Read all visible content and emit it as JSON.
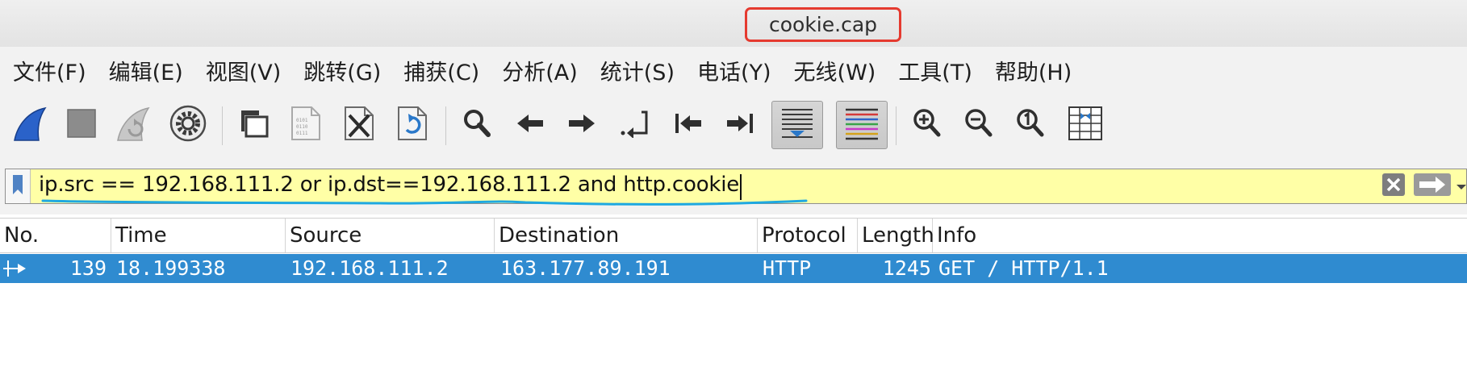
{
  "window": {
    "title": "cookie.cap"
  },
  "menu": [
    "文件(F)",
    "编辑(E)",
    "视图(V)",
    "跳转(G)",
    "捕获(C)",
    "分析(A)",
    "统计(S)",
    "电话(Y)",
    "无线(W)",
    "工具(T)",
    "帮助(H)"
  ],
  "toolbar": {
    "icons": [
      "shark-fin-start-icon",
      "stop-icon",
      "restart-icon",
      "capture-options-icon",
      "open-file-icon",
      "save-file-icon",
      "close-file-icon",
      "reload-file-icon",
      "find-packet-icon",
      "go-back-icon",
      "go-forward-icon",
      "go-to-packet-icon",
      "first-packet-icon",
      "last-packet-icon",
      "autoscroll-icon",
      "colorize-icon",
      "zoom-in-icon",
      "zoom-out-icon",
      "normal-size-icon",
      "resize-columns-icon"
    ]
  },
  "filter": {
    "value": "ip.src == 192.168.111.2 or ip.dst==192.168.111.2 and http.cookie",
    "background_color": "#ffffa6"
  },
  "columns": [
    "No.",
    "Time",
    "Source",
    "Destination",
    "Protocol",
    "Length",
    "Info"
  ],
  "packets": [
    {
      "no": "139",
      "time": "18.199338",
      "source": "192.168.111.2",
      "destination": "163.177.89.191",
      "protocol": "HTTP",
      "length": "1245",
      "info": "GET / HTTP/1.1",
      "selected": true
    }
  ],
  "colors": {
    "selection": "#2f8bd0",
    "title_highlight": "#e53a2f",
    "annotation_underline": "#1ea8e0"
  }
}
